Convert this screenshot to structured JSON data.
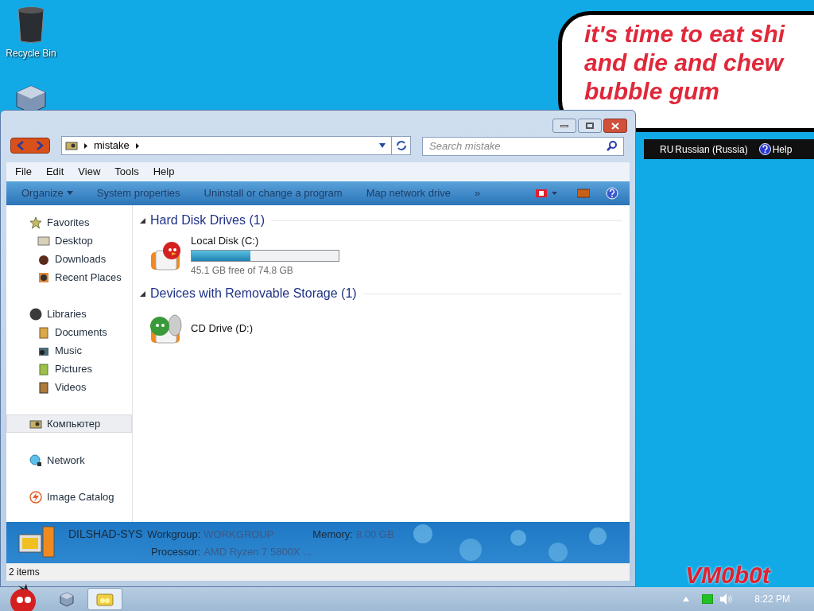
{
  "desktop": {
    "icons": [
      {
        "label": "Recycle Bin",
        "kind": "bin"
      },
      {
        "kind": "box"
      }
    ],
    "bubble_lines": [
      "it's time to eat shi",
      "and die and chew",
      "bubble gum"
    ],
    "signature": "VM0b0t"
  },
  "language_bar": {
    "code": "RU",
    "language": "Russian (Russia)",
    "help": "Help"
  },
  "window": {
    "address": [
      "mistake"
    ],
    "search": {
      "placeholder": "Search mistake"
    },
    "menu": [
      "File",
      "Edit",
      "View",
      "Tools",
      "Help"
    ],
    "toolbar": [
      {
        "label": "Organize",
        "kind": "dropdown"
      },
      {
        "label": "System properties",
        "kind": "plain"
      },
      {
        "label": "Uninstall or change a program",
        "kind": "plain"
      },
      {
        "label": "Map network drive",
        "kind": "plain"
      },
      {
        "label": "»",
        "kind": "plain"
      }
    ],
    "sidebar": [
      {
        "label": "Favorites",
        "kind": "star",
        "selected": false,
        "children": [
          {
            "label": "Desktop",
            "kind": "desktop",
            "selected": false
          },
          {
            "label": "Downloads",
            "kind": "downloads",
            "selected": false
          },
          {
            "label": "Recent Places",
            "kind": "recent",
            "selected": false
          }
        ]
      },
      {
        "label": "Libraries",
        "kind": "libraries",
        "selected": false,
        "children": [
          {
            "label": "Documents",
            "kind": "documents",
            "selected": false
          },
          {
            "label": "Music",
            "kind": "music",
            "selected": false
          },
          {
            "label": "Pictures",
            "kind": "pictures",
            "selected": false
          },
          {
            "label": "Videos",
            "kind": "videos",
            "selected": false
          }
        ]
      },
      {
        "label": "Компьютер",
        "kind": "computer",
        "selected": true
      },
      {
        "label": "Network",
        "kind": "network",
        "selected": false
      },
      {
        "label": "Image Catalog",
        "kind": "catalog",
        "selected": false
      }
    ],
    "sections": [
      {
        "title": "Hard Disk Drives (1)",
        "drives": [
          {
            "kind": "disk",
            "name": "Local Disk (C:)",
            "level": 0.4,
            "reading": "45.1 GB free of 74.8 GB"
          }
        ]
      },
      {
        "title": "Devices with Removable Storage (1)",
        "drives": [
          {
            "kind": "cd",
            "name": "CD Drive (D:)"
          }
        ]
      }
    ],
    "details": {
      "name": "DILSHAD-SYS",
      "fields": [
        {
          "label": "Workgroup:",
          "value": "WORKGROUP"
        },
        {
          "label": "Memory:",
          "value": "8.00 GB"
        },
        {
          "label": "Processor:",
          "value": "AMD Ryzen 7 5800X ..."
        }
      ]
    },
    "status": "2 items"
  },
  "taskbar": {
    "buttons": [
      {
        "kind": "start",
        "selected": false
      },
      {
        "kind": "box",
        "selected": false
      },
      {
        "kind": "explorer",
        "selected": true
      }
    ],
    "clock": "8:22 PM"
  }
}
